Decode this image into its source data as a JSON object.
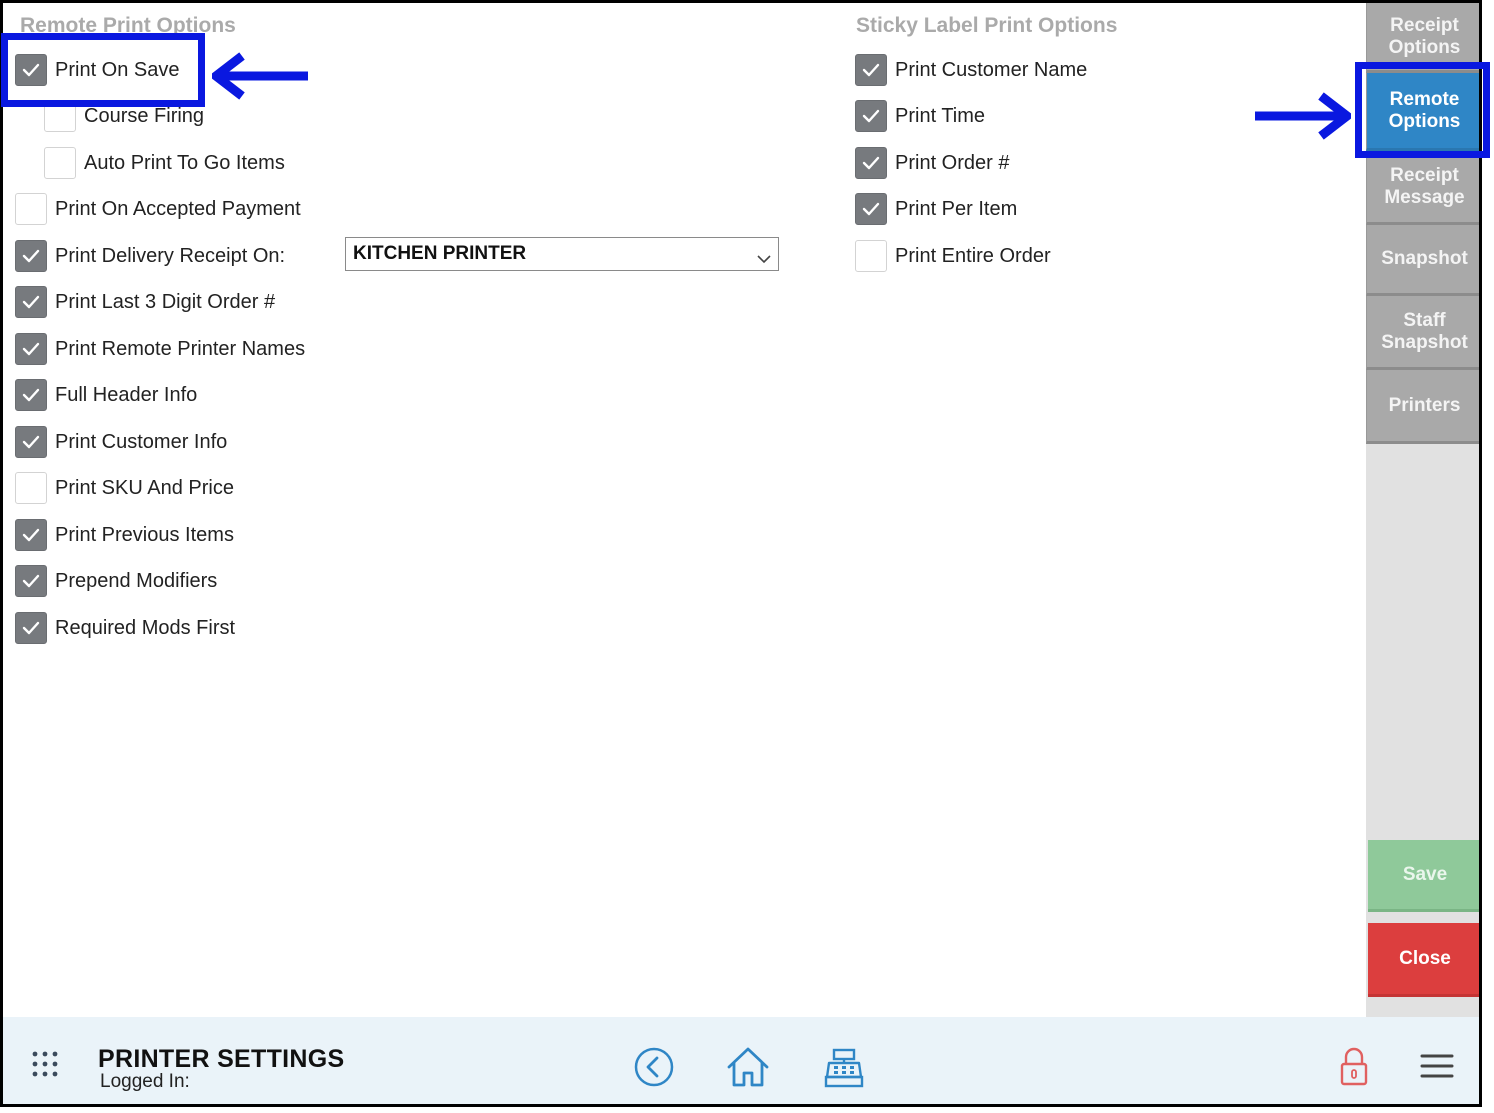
{
  "remote_section": {
    "title": "Remote Print Options",
    "options": [
      {
        "label": "Print On Save",
        "checked": true
      },
      {
        "label": "Course Firing",
        "checked": false
      },
      {
        "label": "Auto Print To Go Items",
        "checked": false
      },
      {
        "label": "Print On Accepted Payment",
        "checked": false
      },
      {
        "label": "Print Delivery Receipt On:",
        "checked": true
      },
      {
        "label": "Print Last 3 Digit Order #",
        "checked": true
      },
      {
        "label": "Print Remote Printer Names",
        "checked": true
      },
      {
        "label": "Full Header Info",
        "checked": true
      },
      {
        "label": "Print Customer Info",
        "checked": true
      },
      {
        "label": "Print SKU And Price",
        "checked": false
      },
      {
        "label": "Print Previous Items",
        "checked": true
      },
      {
        "label": "Prepend Modifiers",
        "checked": true
      },
      {
        "label": "Required Mods First",
        "checked": true
      }
    ],
    "delivery_printer": "KITCHEN PRINTER"
  },
  "sticky_section": {
    "title": "Sticky Label Print Options",
    "options": [
      {
        "label": "Print Customer Name",
        "checked": true
      },
      {
        "label": "Print Time",
        "checked": true
      },
      {
        "label": "Print Order #",
        "checked": true
      },
      {
        "label": "Print Per Item",
        "checked": true
      },
      {
        "label": "Print Entire Order",
        "checked": false
      }
    ]
  },
  "side_nav": {
    "items": [
      {
        "label": "Receipt\nOptions",
        "active": false
      },
      {
        "label": "Remote\nOptions",
        "active": true
      },
      {
        "label": "Receipt\nMessage",
        "active": false
      },
      {
        "label": "Snapshot",
        "active": false
      },
      {
        "label": "Staff\nSnapshot",
        "active": false
      },
      {
        "label": "Printers",
        "active": false
      }
    ],
    "save_label": "Save",
    "close_label": "Close"
  },
  "footer": {
    "page_title": "PRINTER SETTINGS",
    "logged_in_label": "Logged In:",
    "icons": [
      "apps-grid-icon",
      "back-circle-icon",
      "home-icon",
      "cash-register-icon",
      "lock-icon",
      "hamburger-menu-icon"
    ]
  },
  "colors": {
    "checkbox_on": "#777a7e",
    "nav_active": "#2f86c6",
    "nav_inactive": "#a9a9a9",
    "save_button": "#8fc99a",
    "close_button": "#dc3e3e",
    "annotation": "#0a18e0",
    "footer_bg": "#eaf3f9",
    "icon_blue": "#2f86c6",
    "lock_red": "#e06060"
  }
}
